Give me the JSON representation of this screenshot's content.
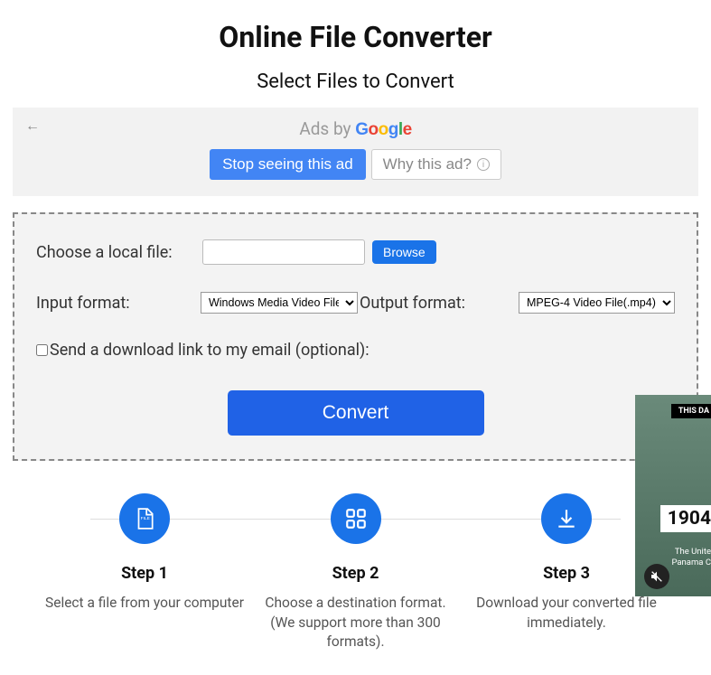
{
  "title": "Online File Converter",
  "subtitle": "Select Files to Convert",
  "ad": {
    "label_prefix": "Ads by ",
    "stop": "Stop seeing this ad",
    "why": "Why this ad?"
  },
  "form": {
    "choose_label": "Choose a local file:",
    "browse": "Browse",
    "input_format_label": "Input format:",
    "input_format_value": "Windows Media Video File(.wmv)",
    "output_format_label": "Output format:",
    "output_format_value": "MPEG-4 Video File(.mp4)",
    "email_label": "Send a download link to my email (optional):",
    "convert": "Convert"
  },
  "steps": [
    {
      "title": "Step 1",
      "desc": "Select a file from your computer"
    },
    {
      "title": "Step 2",
      "desc": "Choose a destination format. (We support more than 300 formats)."
    },
    {
      "title": "Step 3",
      "desc": "Download your converted file immediately."
    }
  ],
  "video": {
    "banner": "THIS DA",
    "year": "1904",
    "line1": "The Unite",
    "line2": "Panama C"
  }
}
